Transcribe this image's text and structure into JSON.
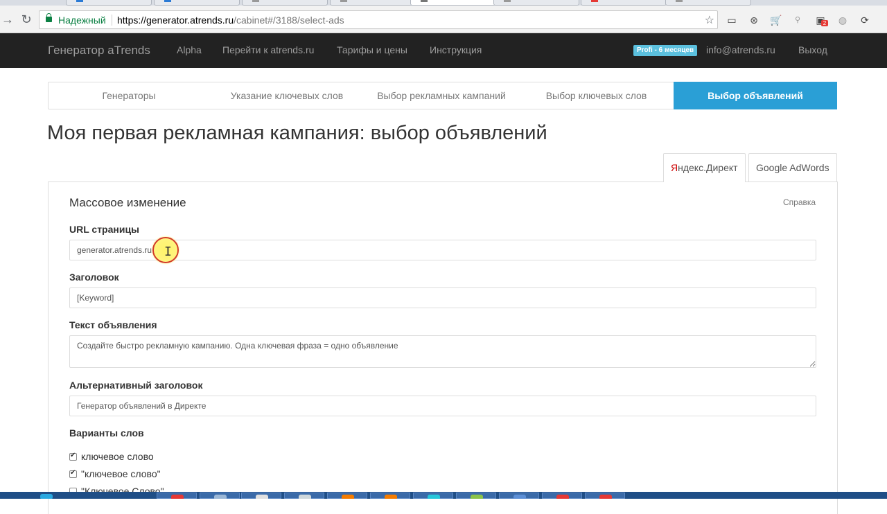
{
  "browser": {
    "security_label": "Надежный",
    "url_host": "https://generator.atrends.ru",
    "url_path": "/cabinet#/3188/select-ads",
    "extension_badge_count": "2"
  },
  "navbar": {
    "brand": "Генератор aTrends",
    "links": [
      "Alpha",
      "Перейти к atrends.ru",
      "Тарифы и цены",
      "Инструкция"
    ],
    "badge": "Profi - 6 месяцев",
    "email": "info@atrends.ru",
    "logout": "Выход"
  },
  "steps": [
    {
      "label": "Генераторы",
      "active": false
    },
    {
      "label": "Указание ключевых слов",
      "active": false
    },
    {
      "label": "Выбор рекламных кампаний",
      "active": false
    },
    {
      "label": "Выбор ключевых слов",
      "active": false
    },
    {
      "label": "Выбор объявлений",
      "active": true
    }
  ],
  "page_title": "Моя первая рекламная кампания: выбор объявлений",
  "platform_tabs": [
    {
      "label": "Яндекс.Директ",
      "active": true
    },
    {
      "label": "Google AdWords",
      "active": false
    }
  ],
  "panel": {
    "title": "Массовое изменение",
    "help_link": "Справка"
  },
  "form": {
    "url": {
      "label": "URL страницы",
      "value": "generator.atrends.ru"
    },
    "headline": {
      "label": "Заголовок",
      "value": "[Keyword]"
    },
    "ad_text": {
      "label": "Текст объявления",
      "value": "Создайте быстро рекламную кампанию. Одна ключевая фраза = одно объявление"
    },
    "alt_headline": {
      "label": "Альтернативный заголовок",
      "value": "Генератор объявлений в Директе"
    },
    "word_variants": {
      "label": "Варианты слов",
      "options": [
        {
          "label": "ключевое слово",
          "checked": true
        },
        {
          "label": "\"ключевое слово\"",
          "checked": true
        },
        {
          "label": "\"Ключевое Слово\"",
          "checked": false
        }
      ]
    }
  },
  "colors": {
    "navbar_bg": "#222222",
    "accent": "#2a9fd6",
    "badge": "#5bc0de",
    "secure_green": "#0b8043"
  }
}
